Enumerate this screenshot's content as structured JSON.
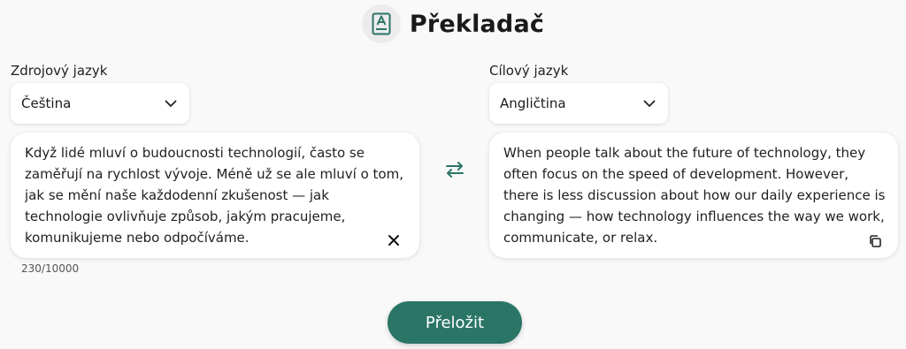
{
  "app": {
    "title": "Překladač",
    "logo_icon": "translate-book-icon",
    "accent_color": "#2a7566"
  },
  "source": {
    "label": "Zdrojový jazyk",
    "selected_language": "Čeština",
    "text": "Když lidé mluví o budoucnosti technologií, často se zaměřují na rychlost vývoje. Méně už se ale mluví o tom, jak se mění naše každodenní zkušenost — jak technologie ovlivňuje způsob, jakým pracujeme, komunikujeme nebo odpočíváme.",
    "char_counter": "230/10000",
    "clear_icon": "close-icon"
  },
  "target": {
    "label": "Cílový jazyk",
    "selected_language": "Angličtina",
    "text": "When people talk about the future of technology, they often focus on the speed of development. However, there is less discussion about how our daily experience is changing — how technology influences the way we work, communicate, or relax.",
    "copy_icon": "copy-icon"
  },
  "swap_icon": "swap-icon",
  "translate_button": {
    "label": "Přeložit"
  }
}
